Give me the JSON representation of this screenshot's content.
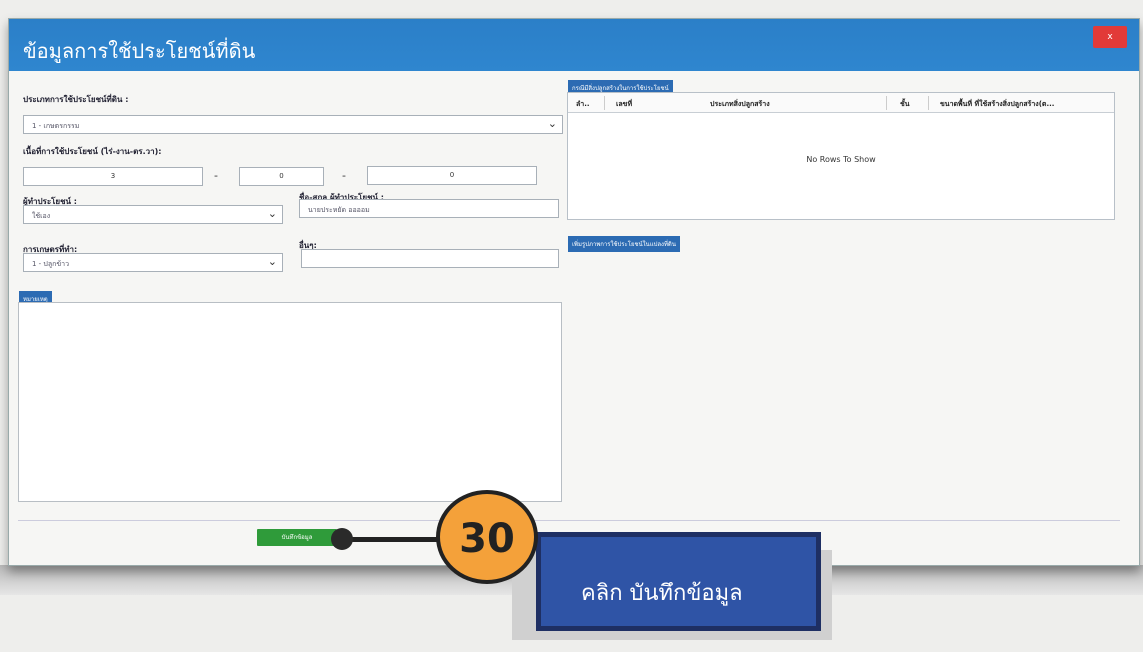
{
  "dialog": {
    "title": "ข้อมูลการใช้ประโยชน์ที่ดิน",
    "close_label": "x"
  },
  "form": {
    "land_use_label": "ประเภทการใช้ประโยชน์ที่ดิน :",
    "land_use_value": "1 - เกษตรกรรม",
    "area_label": "เนื้อที่การใช้ประโยชน์ (ไร่-งาน-ตร.วา):",
    "area_rai": "3",
    "area_ngan": "0",
    "area_wa": "0",
    "dash": "-",
    "user_label": "ผู้ทำประโยชน์ :",
    "user_value": "ใช้เอง",
    "user_name_label": "ชื่อ-สกุล ผู้ทำประโยชน์ :",
    "user_name_value": "นายประหยัด ออออม",
    "activity_label": "การเกษตรที่ทำ:",
    "activity_value": "1 - ปลูกข้าว",
    "other_label": "อื่นๆ:",
    "notes_tag": "หมายเหตุ"
  },
  "grid": {
    "section_tag": "กรณีมีสิ่งปลูกสร้างในการใช้ประโยชน์",
    "columns": [
      "ลำ..",
      "เลขที่",
      "ประเภทสิ่งปลูกสร้าง",
      "ชั้น",
      "ขนาดพื้นที่ ที่ใช้สร้างสิ่งปลูกสร้าง(ต..."
    ],
    "empty_text": "No Rows To Show",
    "add_button": "เพิ่มรูปภาพการใช้ประโยชน์ในแปลงที่ดิน"
  },
  "footer": {
    "save_label": "บันทึกข้อมูล"
  },
  "annotation": {
    "step_number": "30",
    "callout_text": "คลิก บันทึกข้อมูล"
  },
  "colors": {
    "titlebar": "#2b7fc8",
    "save_button": "#2f9b3a",
    "step_circle": "#f4a13a",
    "callout": "#2f54a6",
    "close_button": "#e23a38"
  }
}
